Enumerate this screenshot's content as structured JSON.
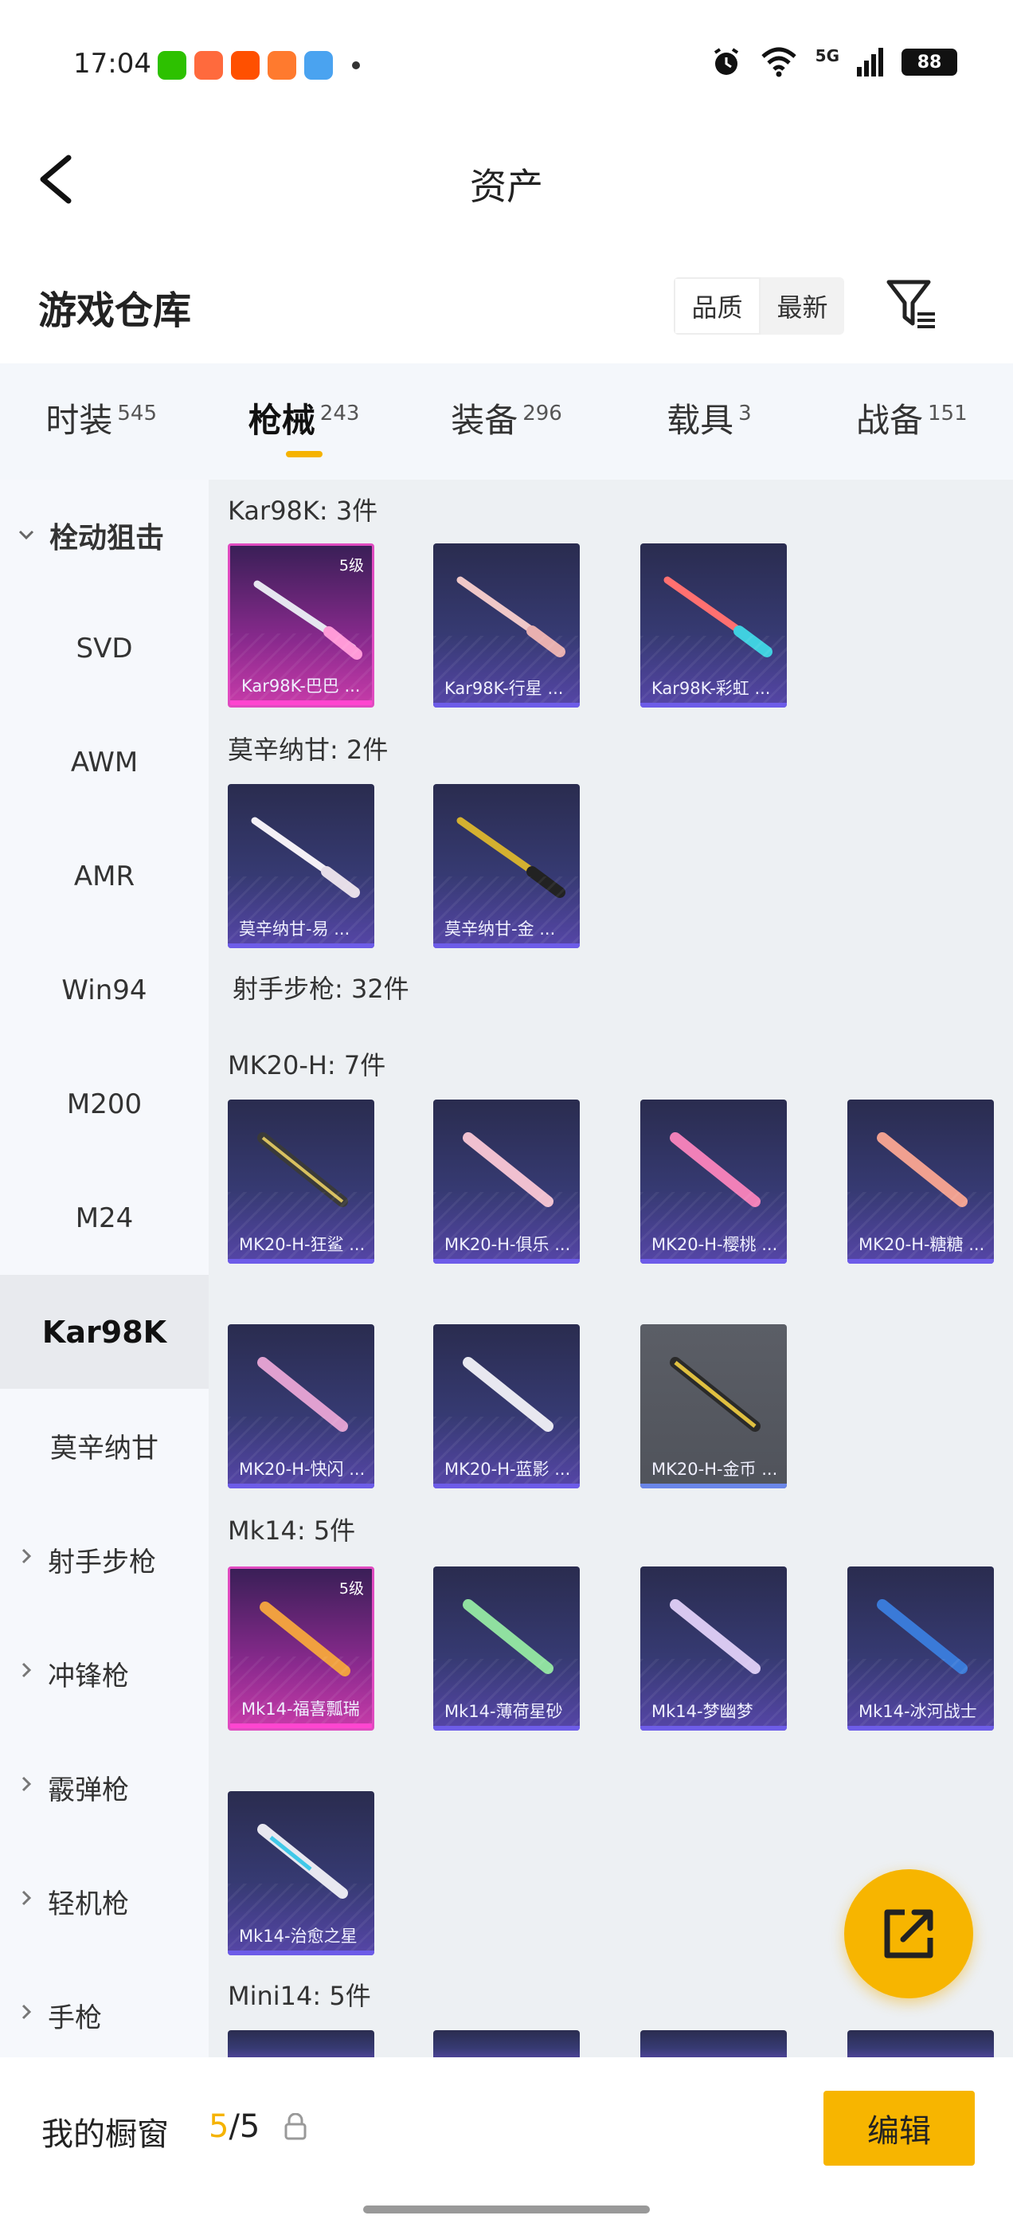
{
  "status_bar": {
    "time": "17:04",
    "network": "5G",
    "battery": "88",
    "app_icons": [
      "wechat-icon",
      "game-icon",
      "taobao-icon",
      "app-icon",
      "weather-icon"
    ]
  },
  "header": {
    "title": "资产"
  },
  "warehouse": {
    "title": "游戏仓库",
    "sort_options": [
      "品质",
      "最新"
    ]
  },
  "tabs": [
    {
      "label": "时装",
      "count": "545"
    },
    {
      "label": "枪械",
      "count": "243",
      "active": true
    },
    {
      "label": "装备",
      "count": "296"
    },
    {
      "label": "载具",
      "count": "3"
    },
    {
      "label": "战备",
      "count": "151"
    }
  ],
  "sidebar": {
    "group_open": "栓动狙击",
    "items": [
      "SVD",
      "AWM",
      "AMR",
      "Win94",
      "M200",
      "M24",
      "Kar98K",
      "莫辛纳甘"
    ],
    "active": "Kar98K",
    "groups": [
      "射手步枪",
      "冲锋枪",
      "霰弹枪",
      "轻机枪",
      "手枪"
    ]
  },
  "sections": {
    "kar98k": {
      "title": "Kar98K: 3件",
      "items": [
        "Kar98K-巴巴 ...",
        "Kar98K-行星 ...",
        "Kar98K-彩虹 ..."
      ],
      "level": "5级"
    },
    "mosin": {
      "title": "莫辛纳甘: 2件",
      "items": [
        "莫辛纳甘-易 ...",
        "莫辛纳甘-金 ..."
      ]
    },
    "dmr": {
      "title": "射手步枪: 32件"
    },
    "mk20": {
      "title": "MK20-H: 7件",
      "items": [
        "MK20-H-狂鲨 ...",
        "MK20-H-俱乐 ...",
        "MK20-H-樱桃 ...",
        "MK20-H-糖糖 ...",
        "MK20-H-快闪 ...",
        "MK20-H-蓝影 ...",
        "MK20-H-金币 ..."
      ]
    },
    "mk14": {
      "title": "Mk14: 5件",
      "items": [
        "Mk14-福喜瓢瑞",
        "Mk14-薄荷星砂",
        "Mk14-梦幽梦",
        "Mk14-冰河战士",
        "Mk14-治愈之星"
      ],
      "level": "5级"
    },
    "mini14": {
      "title": "Mini14: 5件"
    }
  },
  "bottom": {
    "label": "我的橱窗",
    "count_current": "5",
    "count_total": "/5",
    "edit": "编辑"
  }
}
